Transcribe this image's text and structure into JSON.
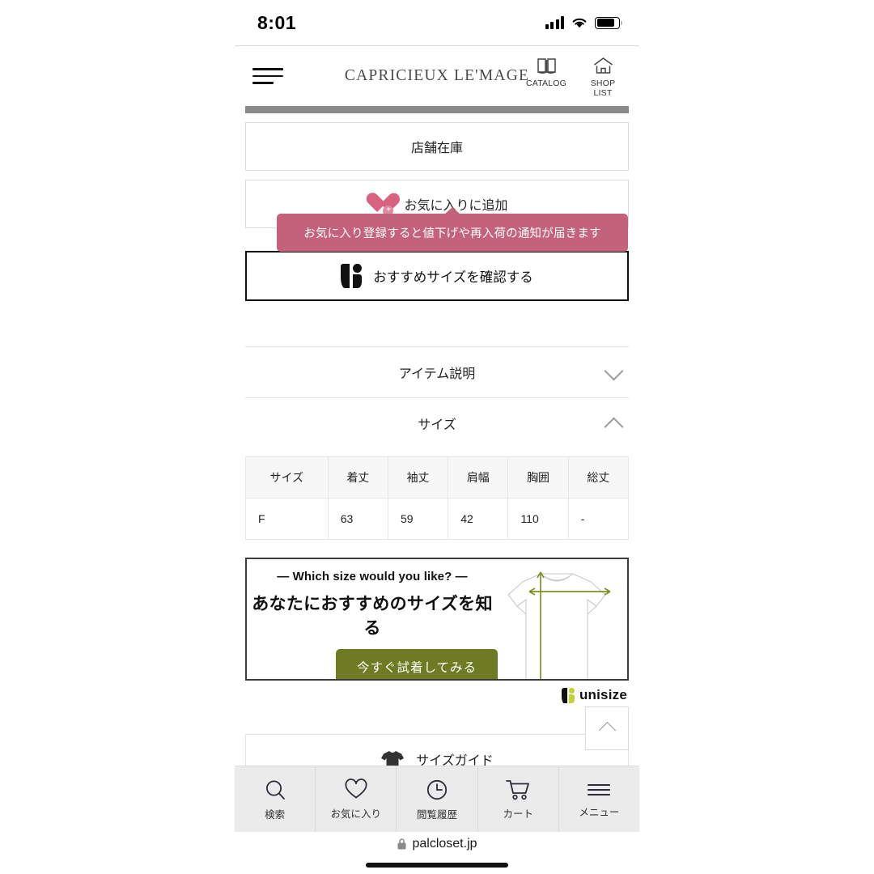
{
  "status_bar": {
    "time": "8:01",
    "signal_icon": "signal-bars-icon",
    "wifi_icon": "wifi-icon",
    "battery_icon": "battery-icon"
  },
  "header": {
    "menu_icon": "hamburger-menu-icon",
    "brand": "CAPRICIEUX LE'MAGE",
    "actions": [
      {
        "label": "CATALOG",
        "icon": "book-icon"
      },
      {
        "label": "SHOP LIST",
        "icon": "house-icon"
      }
    ]
  },
  "product_actions": {
    "store_stock_label": "店舗在庫",
    "favorite_label": "お気に入りに追加",
    "favorite_icon": "heart-plus-icon",
    "tooltip": "お気に入り登録すると値下げや再入荷の通知が届きます",
    "recommend_size_label": "おすすめサイズを確認する",
    "recommend_size_icon": "unisize-logo-icon"
  },
  "accordions": [
    {
      "title": "アイテム説明",
      "state": "collapsed",
      "icon": "chevron-down-icon"
    },
    {
      "title": "サイズ",
      "state": "expanded",
      "icon": "chevron-up-icon"
    }
  ],
  "size_table": {
    "headers": [
      "サイズ",
      "着丈",
      "袖丈",
      "肩幅",
      "胸囲",
      "総丈"
    ],
    "rows": [
      [
        "F",
        "63",
        "59",
        "42",
        "110",
        "-"
      ]
    ]
  },
  "unisize_banner": {
    "eyebrow": "—  Which size would you like?  —",
    "title": "あなたにおすすめのサイズを知る",
    "cta_label": "今すぐ試着してみる",
    "cta_color": "#6e7b23",
    "shirt_icon": "tshirt-measurement-diagram",
    "logo_word": "unisize",
    "logo_accent": "#c2d22f"
  },
  "scroll_top": {
    "icon": "chevron-up-icon"
  },
  "size_guide": {
    "label": "サイズガイド",
    "icon": "tshirt-icon"
  },
  "bottom_nav": [
    {
      "label": "検索",
      "icon": "search-icon"
    },
    {
      "label": "お気に入り",
      "icon": "heart-outline-icon"
    },
    {
      "label": "閲覧履歴",
      "icon": "clock-icon"
    },
    {
      "label": "カート",
      "icon": "cart-icon"
    },
    {
      "label": "メニュー",
      "icon": "hamburger-menu-icon"
    }
  ],
  "url_bar": {
    "lock_icon": "lock-icon",
    "url": "palcloset.jp"
  }
}
